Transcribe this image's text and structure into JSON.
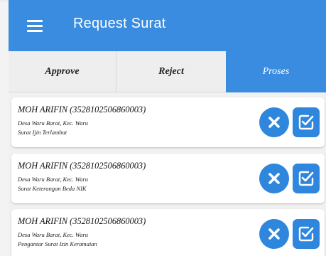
{
  "appbar": {
    "title": "Request Surat",
    "menu_icon": "hamburger-menu-icon"
  },
  "colors": {
    "primary": "#3a8ce0",
    "action": "#2e86dd",
    "tab_inactive": "#eeeeee",
    "background": "#f1f1f1"
  },
  "tabs": [
    {
      "label": "Approve",
      "active": false
    },
    {
      "label": "Reject",
      "active": false
    },
    {
      "label": "Proses",
      "active": true
    }
  ],
  "requests": [
    {
      "name": "MOH ARIFIN (3528102506860003)",
      "address": "Desa Waru Barat, Kec. Waru",
      "letter": "Surat Ijin Terlambat",
      "reject_icon": "close-circle-icon",
      "approve_icon": "check-square-icon"
    },
    {
      "name": "MOH ARIFIN (3528102506860003)",
      "address": "Desa Waru Barat, Kec. Waru",
      "letter": "Surat Keterangan Beda NIK",
      "reject_icon": "close-circle-icon",
      "approve_icon": "check-square-icon"
    },
    {
      "name": "MOH ARIFIN (3528102506860003)",
      "address": "Desa Waru Barat, Kec. Waru",
      "letter": "Pengantar Surat Izin Keramaian",
      "reject_icon": "close-circle-icon",
      "approve_icon": "check-square-icon"
    }
  ]
}
